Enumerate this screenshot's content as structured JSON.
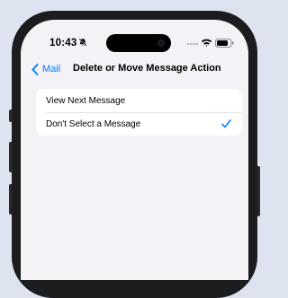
{
  "status_bar": {
    "time": "10:43",
    "icons": [
      "bell-slash-icon",
      "cellular-signal-icon",
      "wifi-icon",
      "battery-icon"
    ]
  },
  "nav": {
    "back_label": "Mail",
    "title": "Delete or Move Message Action"
  },
  "options": [
    {
      "label": "View Next Message",
      "selected": false
    },
    {
      "label": "Don't Select a Message",
      "selected": true
    }
  ],
  "colors": {
    "accent": "#007aff",
    "background": "#f2f2f7",
    "outer_background": "#dde4f0",
    "device_frame": "#1c1c1e"
  }
}
